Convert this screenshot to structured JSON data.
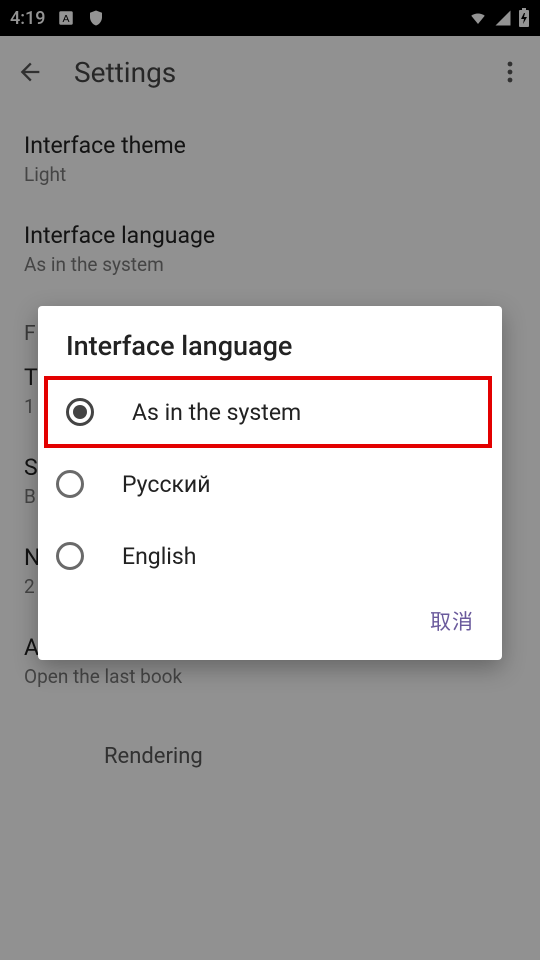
{
  "status": {
    "time": "4:19",
    "icons": [
      "notification-a",
      "shield"
    ],
    "right_icons": [
      "wifi",
      "signal",
      "battery"
    ]
  },
  "appbar": {
    "title": "Settings"
  },
  "settings": {
    "theme": {
      "label": "Interface theme",
      "value": "Light"
    },
    "lang": {
      "label": "Interface language",
      "value": "As in the system"
    },
    "section_f": "F",
    "t_item": {
      "label": "T",
      "value": "1"
    },
    "s_item": {
      "label": "S",
      "value": "B"
    },
    "n_item": {
      "label": "N",
      "value": "2"
    },
    "startup": {
      "label": "Action on startup",
      "value": "Open the last book"
    },
    "rendering": "Rendering"
  },
  "dialog": {
    "title": "Interface language",
    "options": {
      "0": {
        "label": "As in the system",
        "selected": true
      },
      "1": {
        "label": "Русский",
        "selected": false
      },
      "2": {
        "label": "English",
        "selected": false
      }
    },
    "cancel": "取消"
  }
}
